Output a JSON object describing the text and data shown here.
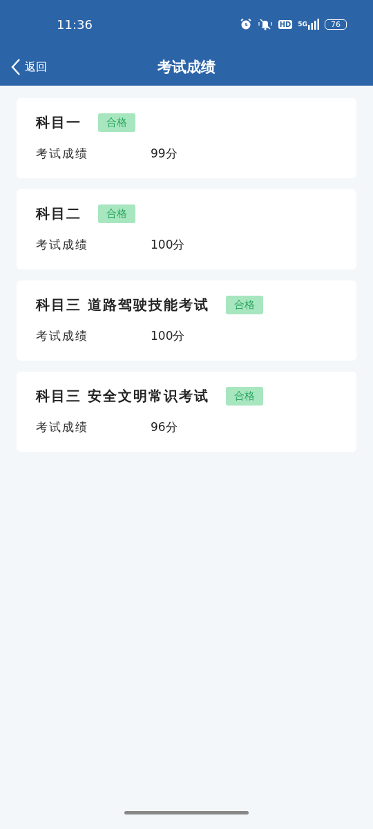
{
  "status_bar": {
    "time": "11:36",
    "hd": "HD",
    "network": "5G",
    "battery": "76"
  },
  "header": {
    "back": "返回",
    "title": "考试成绩"
  },
  "results": [
    {
      "subject": "科目一",
      "badge": "合格",
      "label": "考试成绩",
      "score": "99分"
    },
    {
      "subject": "科目二",
      "badge": "合格",
      "label": "考试成绩",
      "score": "100分"
    },
    {
      "subject": "科目三 道路驾驶技能考试",
      "badge": "合格",
      "label": "考试成绩",
      "score": "100分"
    },
    {
      "subject": "科目三 安全文明常识考试",
      "badge": "合格",
      "label": "考试成绩",
      "score": "96分"
    }
  ]
}
